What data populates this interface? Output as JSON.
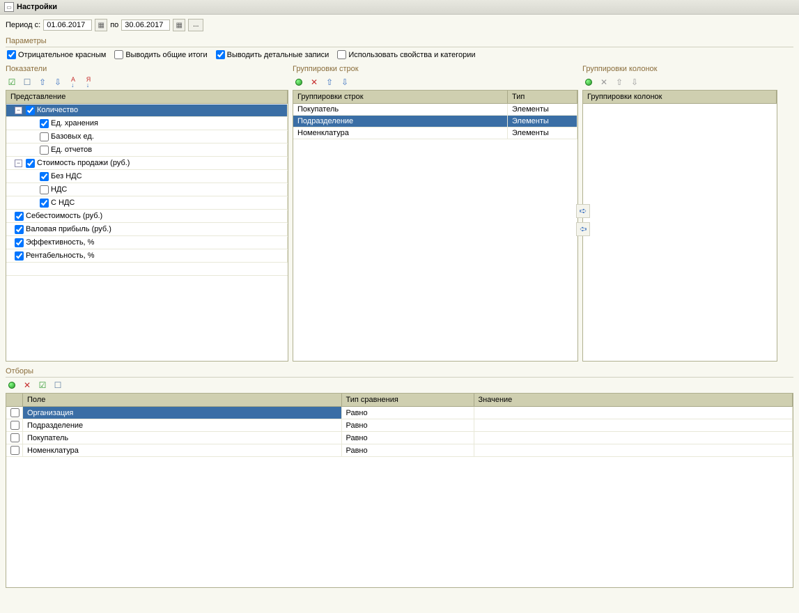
{
  "title": "Настройки",
  "period": {
    "label_from": "Период с:",
    "from": "01.06.2017",
    "label_to": "по",
    "to": "30.06.2017"
  },
  "sections": {
    "parameters": "Параметры",
    "indicators": "Показатели",
    "row_groupings": "Группировки строк",
    "col_groupings": "Группировки колонок",
    "filters": "Отборы"
  },
  "parameters": [
    {
      "label": "Отрицательное красным",
      "checked": true
    },
    {
      "label": "Выводить общие итоги",
      "checked": false
    },
    {
      "label": "Выводить детальные записи",
      "checked": true
    },
    {
      "label": "Использовать свойства и категории",
      "checked": false
    }
  ],
  "indicators": {
    "header": "Представление",
    "items": [
      {
        "label": "Количество",
        "checked": true,
        "expand": true,
        "level": 0,
        "selected": true
      },
      {
        "label": "Ед. хранения",
        "checked": true,
        "level": 1
      },
      {
        "label": "Базовых ед.",
        "checked": false,
        "level": 1
      },
      {
        "label": "Ед. отчетов",
        "checked": false,
        "level": 1
      },
      {
        "label": "Стоимость продажи (руб.)",
        "checked": true,
        "expand": true,
        "level": 0
      },
      {
        "label": "Без НДС",
        "checked": true,
        "level": 1
      },
      {
        "label": "НДС",
        "checked": false,
        "level": 1
      },
      {
        "label": "С НДС",
        "checked": true,
        "level": 1
      },
      {
        "label": "Себестоимость  (руб.)",
        "checked": true,
        "level": 0
      },
      {
        "label": "Валовая прибыль (руб.)",
        "checked": true,
        "level": 0
      },
      {
        "label": "Эффективность, %",
        "checked": true,
        "level": 0
      },
      {
        "label": "Рентабельность, %",
        "checked": true,
        "level": 0
      }
    ]
  },
  "row_groupings": {
    "header_group": "Группировки строк",
    "header_type": "Тип",
    "items": [
      {
        "label": "Покупатель",
        "type": "Элементы",
        "selected": false
      },
      {
        "label": "Подразделение",
        "type": "Элементы",
        "selected": true
      },
      {
        "label": "Номенклатура",
        "type": "Элементы",
        "selected": false
      }
    ]
  },
  "col_groupings": {
    "header": "Группировки колонок"
  },
  "filters": {
    "headers": {
      "field": "Поле",
      "compare": "Тип сравнения",
      "value": "Значение"
    },
    "items": [
      {
        "checked": false,
        "field": "Организация",
        "compare": "Равно",
        "value": "",
        "selected": true
      },
      {
        "checked": false,
        "field": "Подразделение",
        "compare": "Равно",
        "value": ""
      },
      {
        "checked": false,
        "field": "Покупатель",
        "compare": "Равно",
        "value": ""
      },
      {
        "checked": false,
        "field": "Номенклатура",
        "compare": "Равно",
        "value": ""
      }
    ]
  }
}
